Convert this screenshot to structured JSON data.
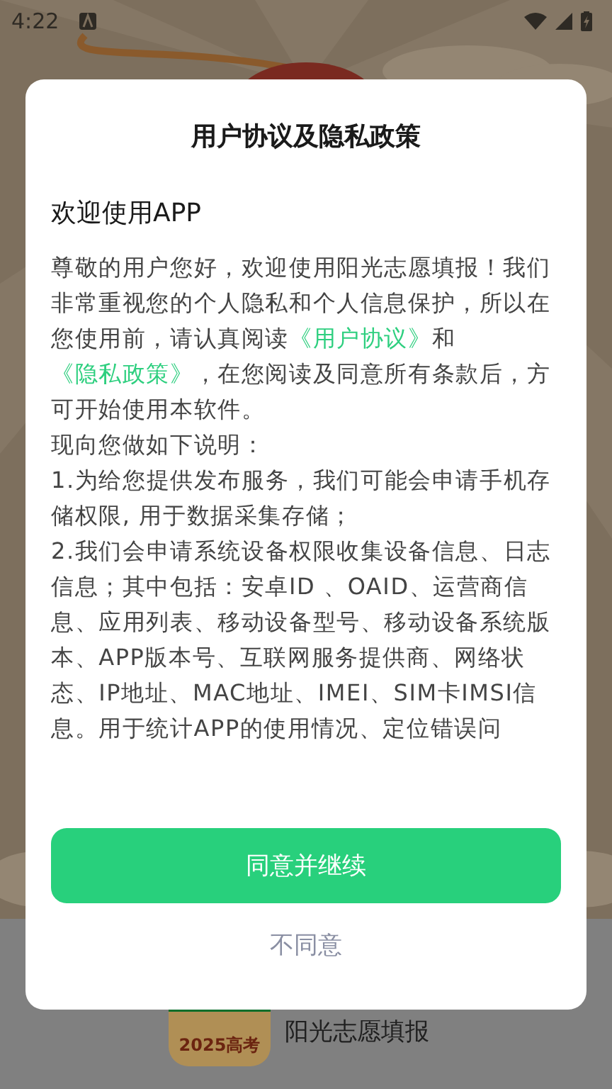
{
  "status_bar": {
    "time": "4:22"
  },
  "dialog": {
    "title": "用户协议及隐私政策",
    "heading": "欢迎使用APP",
    "paragraphs": [
      {
        "parts": [
          {
            "kind": "text",
            "text": "尊敬的用户您好，欢迎使用阳光志愿填报！我们非常重视您的个人隐私和个人信息保护，所以在您使用前，请认真阅读"
          },
          {
            "kind": "link",
            "text": "《用户协议》"
          },
          {
            "kind": "text",
            "text": "和"
          },
          {
            "kind": "link",
            "text": "《隐私政策》"
          },
          {
            "kind": "text",
            "text": "，在您阅读及同意所有条款后，方可开始使用本软件。"
          }
        ]
      },
      {
        "parts": [
          {
            "kind": "text",
            "text": "现向您做如下说明："
          }
        ]
      },
      {
        "parts": [
          {
            "kind": "text",
            "text": "1.为给您提供发布服务，我们可能会申请手机存储权限, 用于数据采集存储；"
          }
        ]
      },
      {
        "parts": [
          {
            "kind": "text",
            "text": "2.我们会申请系统设备权限收集设备信息、日志信息；其中包括：安卓ID 、OAID、运营商信息、应用列表、移动设备型号、移动设备系统版本、APP版本号、互联网服务提供商、网络状态、IP地址、MAC地址、IMEI、SIM卡IMSI信息。用于统计APP的使用情况、定位错误问"
          }
        ]
      }
    ],
    "buttons": [
      {
        "kind": "primary",
        "label": "同意并继续"
      },
      {
        "kind": "text",
        "label": "不同意"
      }
    ]
  },
  "splash": {
    "badge": "2025高考",
    "app_name": "阳光志愿填报"
  }
}
